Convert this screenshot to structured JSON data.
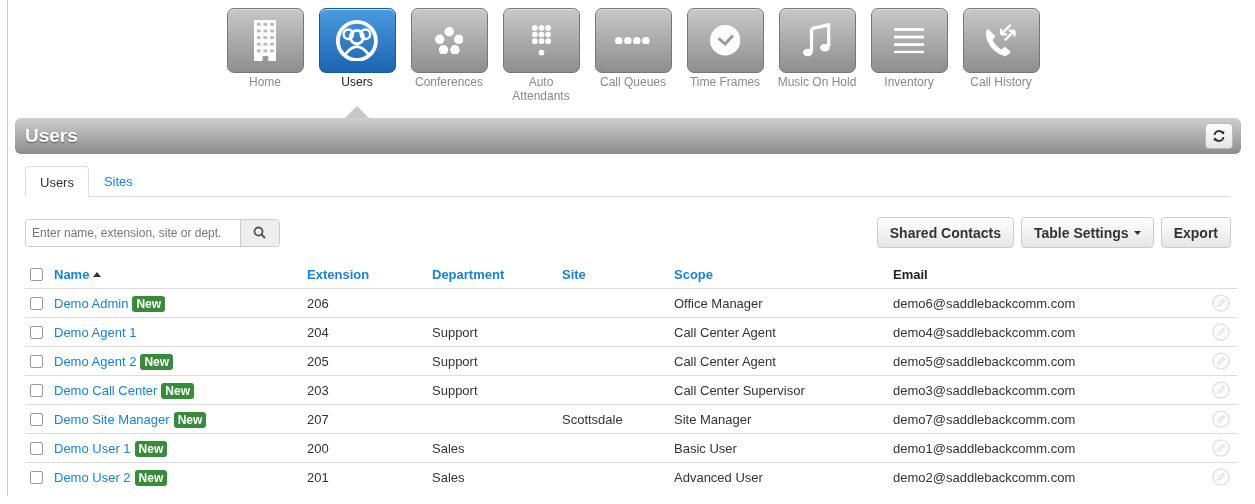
{
  "nav": [
    {
      "label": "Home",
      "selected": false
    },
    {
      "label": "Users",
      "selected": true
    },
    {
      "label": "Conferences",
      "selected": false
    },
    {
      "label": "Auto Attendants",
      "selected": false
    },
    {
      "label": "Call Queues",
      "selected": false
    },
    {
      "label": "Time Frames",
      "selected": false
    },
    {
      "label": "Music On Hold",
      "selected": false
    },
    {
      "label": "Inventory",
      "selected": false
    },
    {
      "label": "Call History",
      "selected": false
    }
  ],
  "panel": {
    "title": "Users"
  },
  "tabs": [
    {
      "label": "Users",
      "selected": true
    },
    {
      "label": "Sites",
      "selected": false
    }
  ],
  "search": {
    "placeholder": "Enter name, extension, site or dept."
  },
  "buttons": [
    {
      "label": "Shared Contacts",
      "dropdown": false
    },
    {
      "label": "Table Settings",
      "dropdown": true
    },
    {
      "label": "Export",
      "dropdown": false
    }
  ],
  "table": {
    "select_all": {
      "checked": false
    },
    "columns": [
      {
        "label": "Name",
        "sortable": true,
        "sorted": true
      },
      {
        "label": "Extension",
        "sortable": true
      },
      {
        "label": "Department",
        "sortable": true
      },
      {
        "label": "Site",
        "sortable": true
      },
      {
        "label": "Scope",
        "sortable": true
      },
      {
        "label": "Email",
        "sortable": false
      }
    ],
    "rows": [
      {
        "checked": false,
        "name": "Demo Admin",
        "badge": "New",
        "extension": "206",
        "scope": "Office Manager",
        "email": "demo6@saddlebackcomm.com"
      },
      {
        "checked": false,
        "name": "Demo Agent 1",
        "extension": "204",
        "department": "Support",
        "scope": "Call Center Agent",
        "email": "demo4@saddlebackcomm.com"
      },
      {
        "checked": false,
        "name": "Demo Agent 2",
        "badge": "New",
        "extension": "205",
        "department": "Support",
        "scope": "Call Center Agent",
        "email": "demo5@saddlebackcomm.com"
      },
      {
        "checked": false,
        "name": "Demo Call Center",
        "badge": "New",
        "extension": "203",
        "department": "Support",
        "scope": "Call Center Supervisor",
        "email": "demo3@saddlebackcomm.com"
      },
      {
        "checked": false,
        "name": "Demo Site Manager",
        "badge": "New",
        "extension": "207",
        "site": "Scottsdale",
        "scope": "Site Manager",
        "email": "demo7@saddlebackcomm.com"
      },
      {
        "checked": false,
        "name": "Demo User 1",
        "badge": "New",
        "extension": "200",
        "department": "Sales",
        "scope": "Basic User",
        "email": "demo1@saddlebackcomm.com"
      },
      {
        "checked": false,
        "name": "Demo User 2",
        "badge": "New",
        "extension": "201",
        "department": "Sales",
        "scope": "Advanced User",
        "email": "demo2@saddlebackcomm.com"
      }
    ]
  }
}
